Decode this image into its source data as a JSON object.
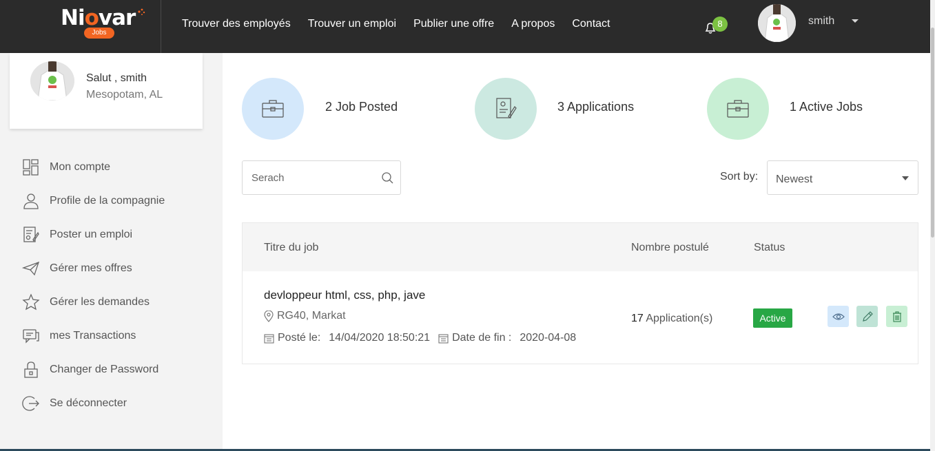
{
  "brand": {
    "name_part1": "Ni",
    "name_o": "o",
    "name_part2": "var",
    "badge": "Jobs"
  },
  "nav": {
    "links": [
      "Trouver des employés",
      "Trouver un emploi",
      "Publier une offre",
      "A propos",
      "Contact"
    ],
    "notification_count": "8",
    "username": "smith"
  },
  "profile": {
    "greeting": "Salut , smith",
    "location": "Mesopotam, AL"
  },
  "sidebar": {
    "items": [
      {
        "label": "Mon compte",
        "icon": "dashboard-icon"
      },
      {
        "label": "Profile de la compagnie",
        "icon": "user-icon"
      },
      {
        "label": "Poster un emploi",
        "icon": "post-job-icon"
      },
      {
        "label": "Gérer mes offres",
        "icon": "paper-plane-icon"
      },
      {
        "label": "Gérer les demandes",
        "icon": "star-icon"
      },
      {
        "label": "mes Transactions",
        "icon": "chat-icon"
      },
      {
        "label": "Changer de Password",
        "icon": "lock-icon"
      },
      {
        "label": "Se déconnecter",
        "icon": "logout-icon"
      }
    ]
  },
  "stats": [
    {
      "label": "2 Job Posted",
      "icon": "briefcase-icon",
      "color": "#d4e8fb"
    },
    {
      "label": "3 Applications",
      "icon": "application-icon",
      "color": "#cce9e1"
    },
    {
      "label": "1 Active Jobs",
      "icon": "briefcase-icon",
      "color": "#c8efd4"
    }
  ],
  "search": {
    "placeholder": "Serach"
  },
  "sort": {
    "label": "Sort by:",
    "value": "Newest"
  },
  "table": {
    "headers": {
      "title": "Titre du job",
      "applied": "Nombre postulé",
      "status": "Status"
    },
    "rows": [
      {
        "title": "devloppeur html, css, php, jave",
        "location": "RG40, Markat",
        "posted_label": "Posté le:",
        "posted_value": "14/04/2020 18:50:21",
        "end_label": "Date de fin :",
        "end_value": "2020-04-08",
        "count": "17",
        "count_suffix": "Application(s)",
        "status": "Active"
      }
    ]
  },
  "colors": {
    "accent": "#f26522",
    "active": "#28a745",
    "notification": "#7cc242",
    "topbar": "#2b2b2b"
  }
}
